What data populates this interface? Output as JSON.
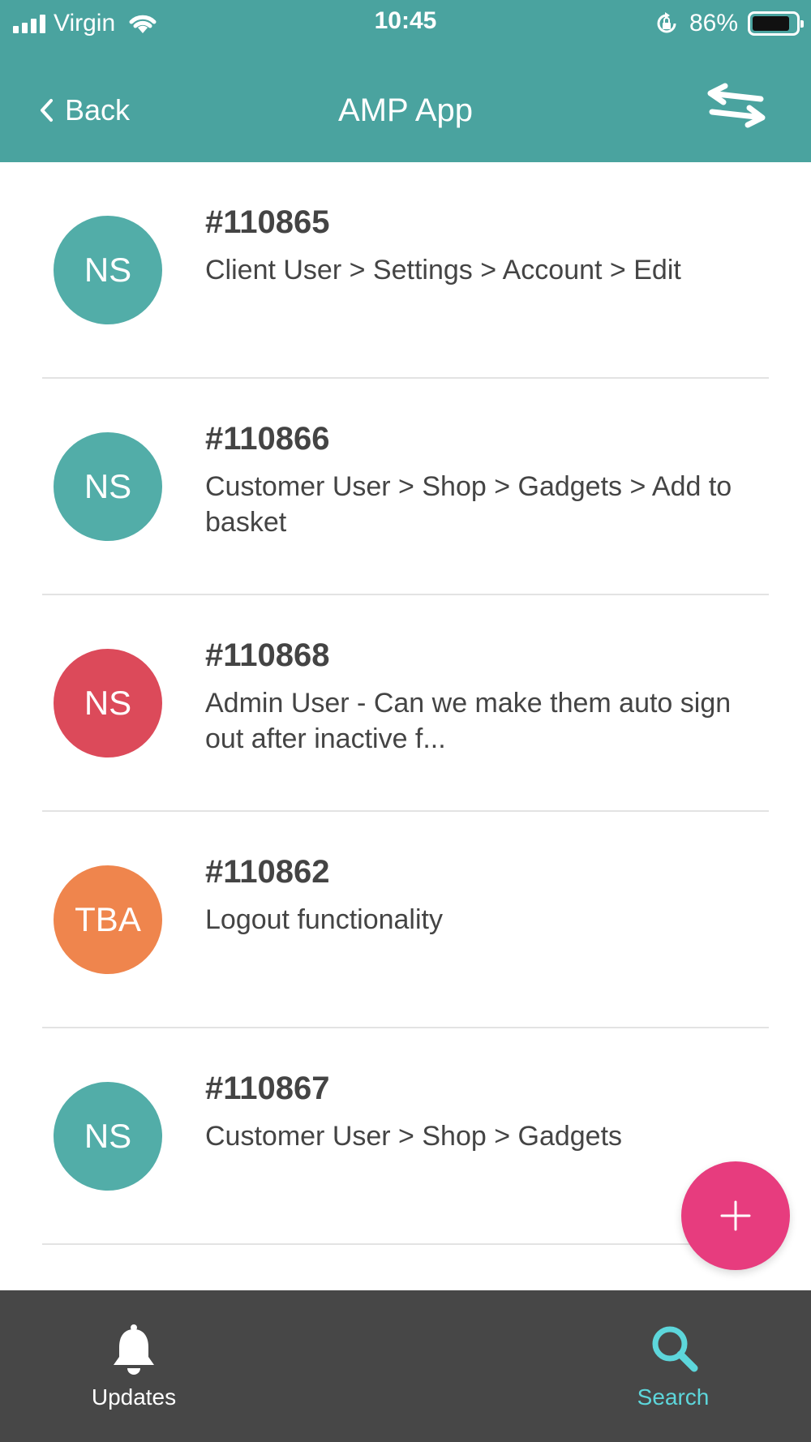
{
  "status_bar": {
    "carrier": "Virgin",
    "time": "10:45",
    "battery_percent": "86%",
    "battery_level": 0.86
  },
  "nav": {
    "back_label": "Back",
    "title": "AMP App",
    "right_icon": "swap-arrows-icon"
  },
  "items": [
    {
      "initials": "NS",
      "color": "#52ada8",
      "id": "#110865",
      "description": "Client User > Settings > Account > Edit"
    },
    {
      "initials": "NS",
      "color": "#52ada8",
      "id": "#110866",
      "description": "Customer User > Shop > Gadgets > Add to basket"
    },
    {
      "initials": "NS",
      "color": "#dc4a5a",
      "id": "#110868",
      "description": "Admin User - Can we make them auto sign out after inactive f..."
    },
    {
      "initials": "TBA",
      "color": "#ef854d",
      "id": "#110862",
      "description": "Logout functionality"
    },
    {
      "initials": "NS",
      "color": "#52ada8",
      "id": "#110867",
      "description": "Customer User > Shop > Gadgets"
    }
  ],
  "fab": {
    "icon": "plus-icon",
    "color": "#e73c7e"
  },
  "tabs": [
    {
      "label": "Updates",
      "icon": "bell-icon",
      "active": false
    },
    {
      "label": "Search",
      "icon": "search-icon",
      "active": true
    }
  ],
  "colors": {
    "header": "#4aa39f",
    "tabbar": "#474747",
    "tab_active": "#5dd6db"
  }
}
